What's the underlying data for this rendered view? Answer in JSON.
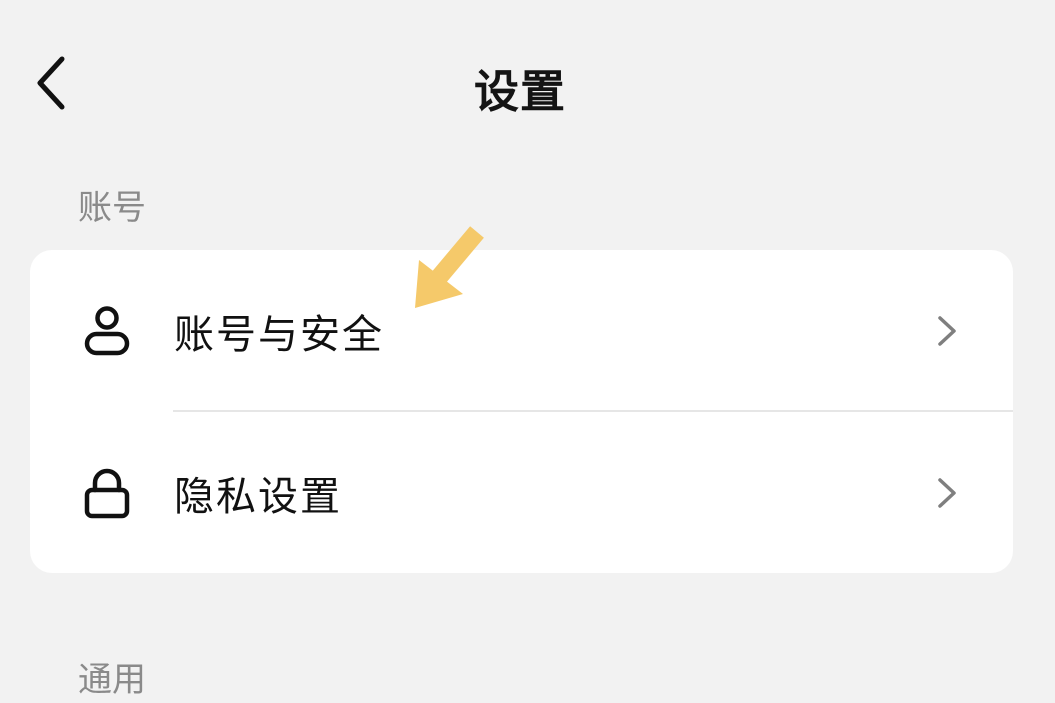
{
  "header": {
    "title": "设置",
    "back_icon": "chevron-left-icon"
  },
  "sections": {
    "account": {
      "label": "账号"
    },
    "general": {
      "label": "通用"
    }
  },
  "account_items": [
    {
      "label": "账号与安全",
      "icon": "user-icon"
    },
    {
      "label": "隐私设置",
      "icon": "lock-icon"
    }
  ],
  "annotation": {
    "icon": "pointer-arrow-icon",
    "color": "#f5c96a"
  }
}
